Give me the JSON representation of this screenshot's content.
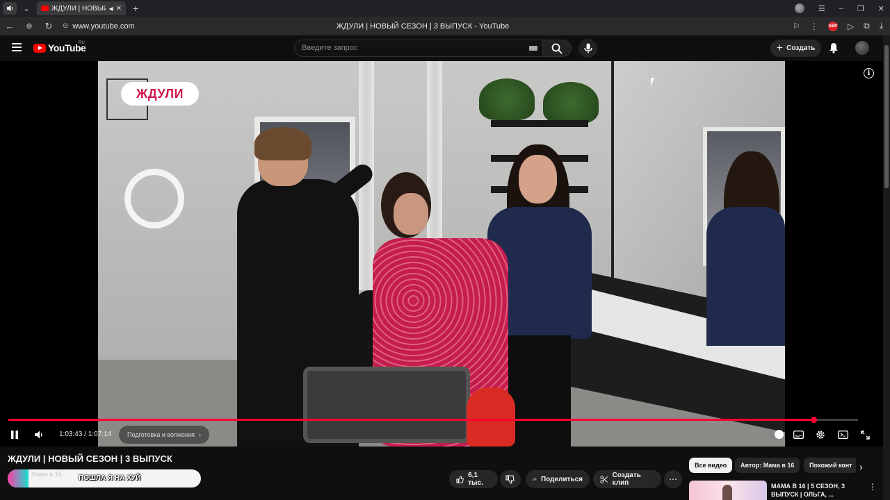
{
  "browser": {
    "tab_title": "ЖДУЛИ | НОВЫЙ С",
    "url": "www.youtube.com",
    "page_title": "ЖДУЛИ | НОВЫЙ СЕЗОН | 3 ВЫПУСК - YouTube",
    "abp_label": "ABP"
  },
  "header": {
    "logo_text": "YouTube",
    "region": "RU",
    "search_placeholder": "Введите запрос",
    "create_label": "Создать"
  },
  "player": {
    "overlay_badge": "ЖДУЛИ",
    "time_current": "1:03:43",
    "time_total": "1:07:14",
    "time_display": "1:03:43 / 1:07:14",
    "chapter": "Подготовка и волнения",
    "progress_fraction": 0.948
  },
  "video": {
    "title": "ЖДУЛИ | НОВЫЙ СЕЗОН | 3 ВЫПУСК",
    "channel_name": "Мама в 16",
    "channel_overlay_text": "ПОШЛА Я НА ХУЙ"
  },
  "actions": {
    "likes": "6,1 тыс.",
    "share": "Поделиться",
    "clip": "Создать клип"
  },
  "sidebar": {
    "chips": [
      {
        "label": "Все видео",
        "active": true
      },
      {
        "label": "Автор: Мама в 16",
        "active": false
      },
      {
        "label": "Похожий конт",
        "active": false
      }
    ],
    "recommendation_title": "МАМА В 16 | 5 СЕЗОН, 3 ВЫПУСК | ОЛЬГА, ..."
  },
  "colors": {
    "accent_red": "#ff0033",
    "badge_text": "#d0144a",
    "background": "#0f0f0f"
  }
}
